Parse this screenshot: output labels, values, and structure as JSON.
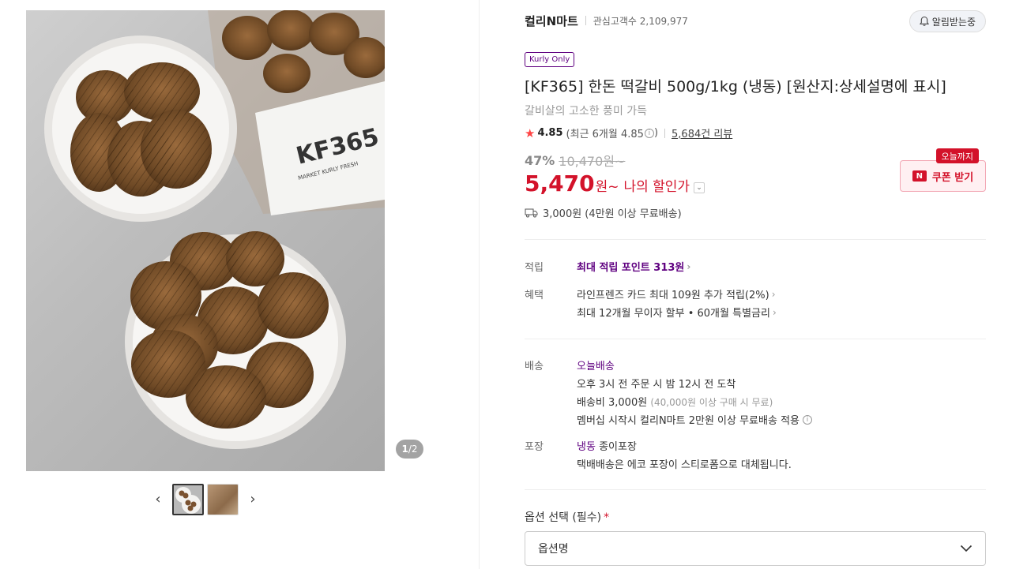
{
  "gallery": {
    "counter_current": "1",
    "counter_total": "/2",
    "prev_icon": "‹",
    "next_icon": "›",
    "package_text": "KF365",
    "package_sub": "MARKET KURLY FRESH"
  },
  "brand": {
    "name": "컬리N마트",
    "fans": "관심고객수 2,109,977",
    "alarm_label": "알림받는중"
  },
  "product": {
    "badge": "Kurly Only",
    "title": "[KF365] 한돈 떡갈비 500g/1kg (냉동) [원산지:상세설명에 표시]",
    "subtitle": "갈비살의 고소한 풍미 가득",
    "rating_score": "4.85",
    "rating_recent": "(최근 6개월 4.85",
    "rating_recent_close": ")",
    "review_count": "5,684건 리뷰"
  },
  "price": {
    "discount_rate": "47%",
    "original": "10,470원~",
    "sale": "5,470",
    "won": "원~",
    "member_label": "나의 할인가",
    "coupon_tag": "오늘까지",
    "coupon_label": "쿠폰 받기",
    "shipping_fee": "3,000원 (4만원 이상 무료배송)"
  },
  "details": {
    "points_label": "적립",
    "points_value": "최대 적립 포인트 313원",
    "benefit_label": "혜택",
    "benefit_1": "라인프렌즈 카드 최대 109원 추가 적립(2%)",
    "benefit_2": "최대 12개월 무이자 할부 • 60개월 특별금리",
    "delivery_label": "배송",
    "delivery_type": "오늘배송",
    "delivery_1": "오후 3시 전 주문 시 밤 12시 전 도착",
    "delivery_fee_main": "배송비 3,000원",
    "delivery_fee_note": "(40,000원 이상 구매 시 무료)",
    "delivery_membership": "멤버십 시작시 컬리N마트 2만원 이상 무료배송 적용",
    "packaging_label": "포장",
    "packaging_type": "냉동",
    "packaging_value": "종이포장",
    "packaging_note": "택배배송은 에코 포장이 스티로폼으로 대체됩니다."
  },
  "option": {
    "label": "옵션 선택 (필수)",
    "required_mark": "*",
    "placeholder": "옵션명"
  },
  "colors": {
    "accent_purple": "#5f0080",
    "price_red": "#d3122a"
  },
  "icons": [
    "bell-icon",
    "star-icon",
    "info-icon",
    "truck-icon",
    "chevron-right-icon",
    "chevron-down-icon",
    "naver-icon"
  ]
}
